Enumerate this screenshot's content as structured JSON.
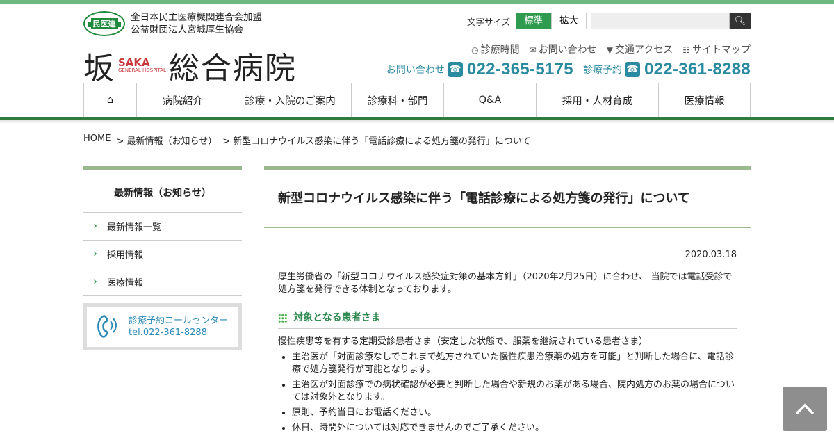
{
  "header": {
    "org_line1": "全日本民主医療機関連合会加盟",
    "org_line2": "公益財団法人宮城厚生協会",
    "org_badge": "民医連",
    "logo_main1": "坂",
    "logo_sub1": "SAKA",
    "logo_sub2": "GENERAL HOSPITAL",
    "logo_main2": "総合病院",
    "font_size_label": "文字サイズ",
    "font_size_standard": "標準",
    "font_size_large": "拡大",
    "search_placeholder": "",
    "util_links": [
      {
        "label": "診療時間",
        "icon": "clock-icon"
      },
      {
        "label": "お問い合わせ",
        "icon": "mail-icon"
      },
      {
        "label": "交通アクセス",
        "icon": "map-pin-icon"
      },
      {
        "label": "サイトマップ",
        "icon": "sitemap-icon"
      }
    ],
    "contact_label": "お問い合わせ",
    "contact_phone": "022-365-5175",
    "reserve_label": "診療予約",
    "reserve_phone": "022-361-8288"
  },
  "nav": [
    "病院紹介",
    "診療・入院のご案内",
    "診療科・部門",
    "Q&A",
    "採用・人材育成",
    "医療情報"
  ],
  "breadcrumb": [
    "HOME",
    "> 最新情報（お知らせ）",
    "> 新型コロナウイルス感染に伴う「電話診療による処方箋の発行」について"
  ],
  "sidebar": {
    "title": "最新情報（お知らせ）",
    "items": [
      "最新情報一覧",
      "採用情報",
      "医療情報"
    ],
    "callcenter_name": "診療予約コールセンター",
    "callcenter_tel": "tel.022-361-8288"
  },
  "article": {
    "title": "新型コロナウイルス感染に伴う「電話診療による処方箋の発行」について",
    "date": "2020.03.18",
    "intro": "厚生労働省の「新型コロナウイルス感染症対策の基本方針」（2020年2月25日）に合わせ、 当院では電話受診で処方箋を発行できる体制となっております。",
    "section_title": "対象となる患者さま",
    "section_lead": "慢性疾患等を有する定期受診患者さま（安定した状態で、服薬を継続されている患者さま）",
    "bullets": [
      "主治医が「対面診療なしでこれまで処方されていた慢性疾患治療薬の処方を可能」と判断した場合に、電話診療で処方箋発行が可能となります。",
      "主治医が対面診療での病状確認が必要と判断した場合や新規のお薬がある場合、院内処方のお薬の場合については対象外となります。",
      "原則、予約当日にお電話ください。",
      "休日、時間外については対応できませんのでご了承ください。"
    ]
  },
  "colors": {
    "green": "#2e9b4e",
    "teal": "#2a8aa0",
    "red": "#c8373a"
  }
}
